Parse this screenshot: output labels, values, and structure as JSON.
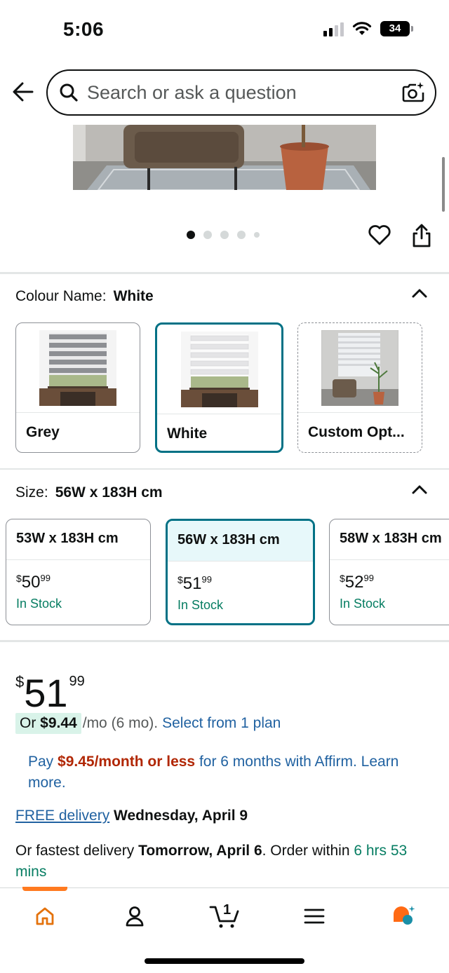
{
  "status_bar": {
    "time": "5:06",
    "battery": "34"
  },
  "search": {
    "placeholder": "Search or ask a question"
  },
  "gallery": {
    "dot_count": 5,
    "active_index": 0
  },
  "colour": {
    "label": "Colour Name:",
    "selected": "White",
    "options": [
      {
        "label": "Grey"
      },
      {
        "label": "White"
      },
      {
        "label": "Custom Opt..."
      }
    ]
  },
  "size": {
    "label": "Size:",
    "selected": "56W x 183H cm",
    "options": [
      {
        "label": "53W x 183H cm",
        "currency": "$",
        "whole": "50",
        "cents": "99",
        "stock": "In Stock"
      },
      {
        "label": "56W x 183H cm",
        "currency": "$",
        "whole": "51",
        "cents": "99",
        "stock": "In Stock"
      },
      {
        "label": "58W x 183H cm",
        "currency": "$",
        "whole": "52",
        "cents": "99",
        "stock": "In Stock"
      }
    ]
  },
  "price": {
    "currency": "$",
    "whole": "51",
    "cents": "99"
  },
  "monthly": {
    "prefix": "Or",
    "amount": "$9.44",
    "term": "/mo (6 mo).",
    "link": "Select from 1 plan"
  },
  "affirm": {
    "prefix": "Pay",
    "amount": "$9.45/month or less",
    "suffix": "for 6 months with Affirm.",
    "link": "Learn more."
  },
  "delivery": {
    "link": "FREE delivery",
    "date": "Wednesday, April 9"
  },
  "fastest": {
    "prefix": "Or fastest delivery",
    "date": "Tomorrow, April 6",
    "middle": ". Order within",
    "countdown": "6 hrs 53 mins"
  },
  "nav": {
    "cart_count": "1"
  },
  "colors": {
    "accent": "#007185",
    "link": "#2162a1",
    "price_red": "#b12704",
    "stock_green": "#067d62",
    "nav_orange": "#ff7a20"
  }
}
